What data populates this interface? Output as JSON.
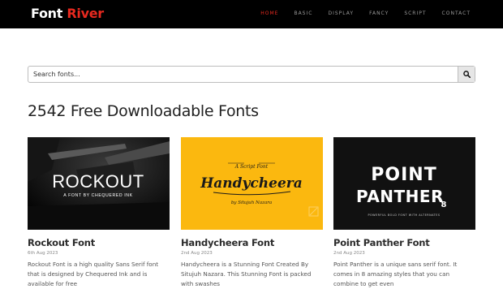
{
  "brand": {
    "part1": "Font ",
    "part2": "River"
  },
  "nav": [
    {
      "label": "HOME",
      "active": true
    },
    {
      "label": "BASIC",
      "active": false
    },
    {
      "label": "DISPLAY",
      "active": false
    },
    {
      "label": "FANCY",
      "active": false
    },
    {
      "label": "SCRIPT",
      "active": false
    },
    {
      "label": "CONTACT",
      "active": false
    }
  ],
  "search": {
    "placeholder": "Search fonts...",
    "value": ""
  },
  "heading": "2542 Free Downloadable Fonts",
  "cards": [
    {
      "title": "Rockout Font",
      "date": "6th Aug 2023",
      "description": "Rockout Font is a high quality Sans Serif font that is designed by Chequered Ink and is available for free",
      "preview_main": "ROCKOUT",
      "preview_sub": "A FONT BY CHEQUERED INK"
    },
    {
      "title": "Handycheera Font",
      "date": "2nd Aug 2023",
      "description": "Handycheera is a Stunning Font Created By Situjuh Nazara. This Stunning Font is packed with swashes",
      "preview_top": "A Script Font",
      "preview_main": "Handycheera",
      "preview_sub": "by Situjuh Nazara"
    },
    {
      "title": "Point Panther Font",
      "date": "2nd Aug 2023",
      "description": "Point Panther is a unique sans serif font. It comes in 8 amazing styles that you can combine to get even",
      "preview_line1": "POINT",
      "preview_line2": "PANTHER",
      "preview_num": "8",
      "preview_sub": "POWERFUL BOLD FONT WITH ALTERNATES"
    }
  ],
  "colors": {
    "accent": "#e8291f",
    "navbar": "#000000",
    "handy_bg": "#fbb80f"
  }
}
